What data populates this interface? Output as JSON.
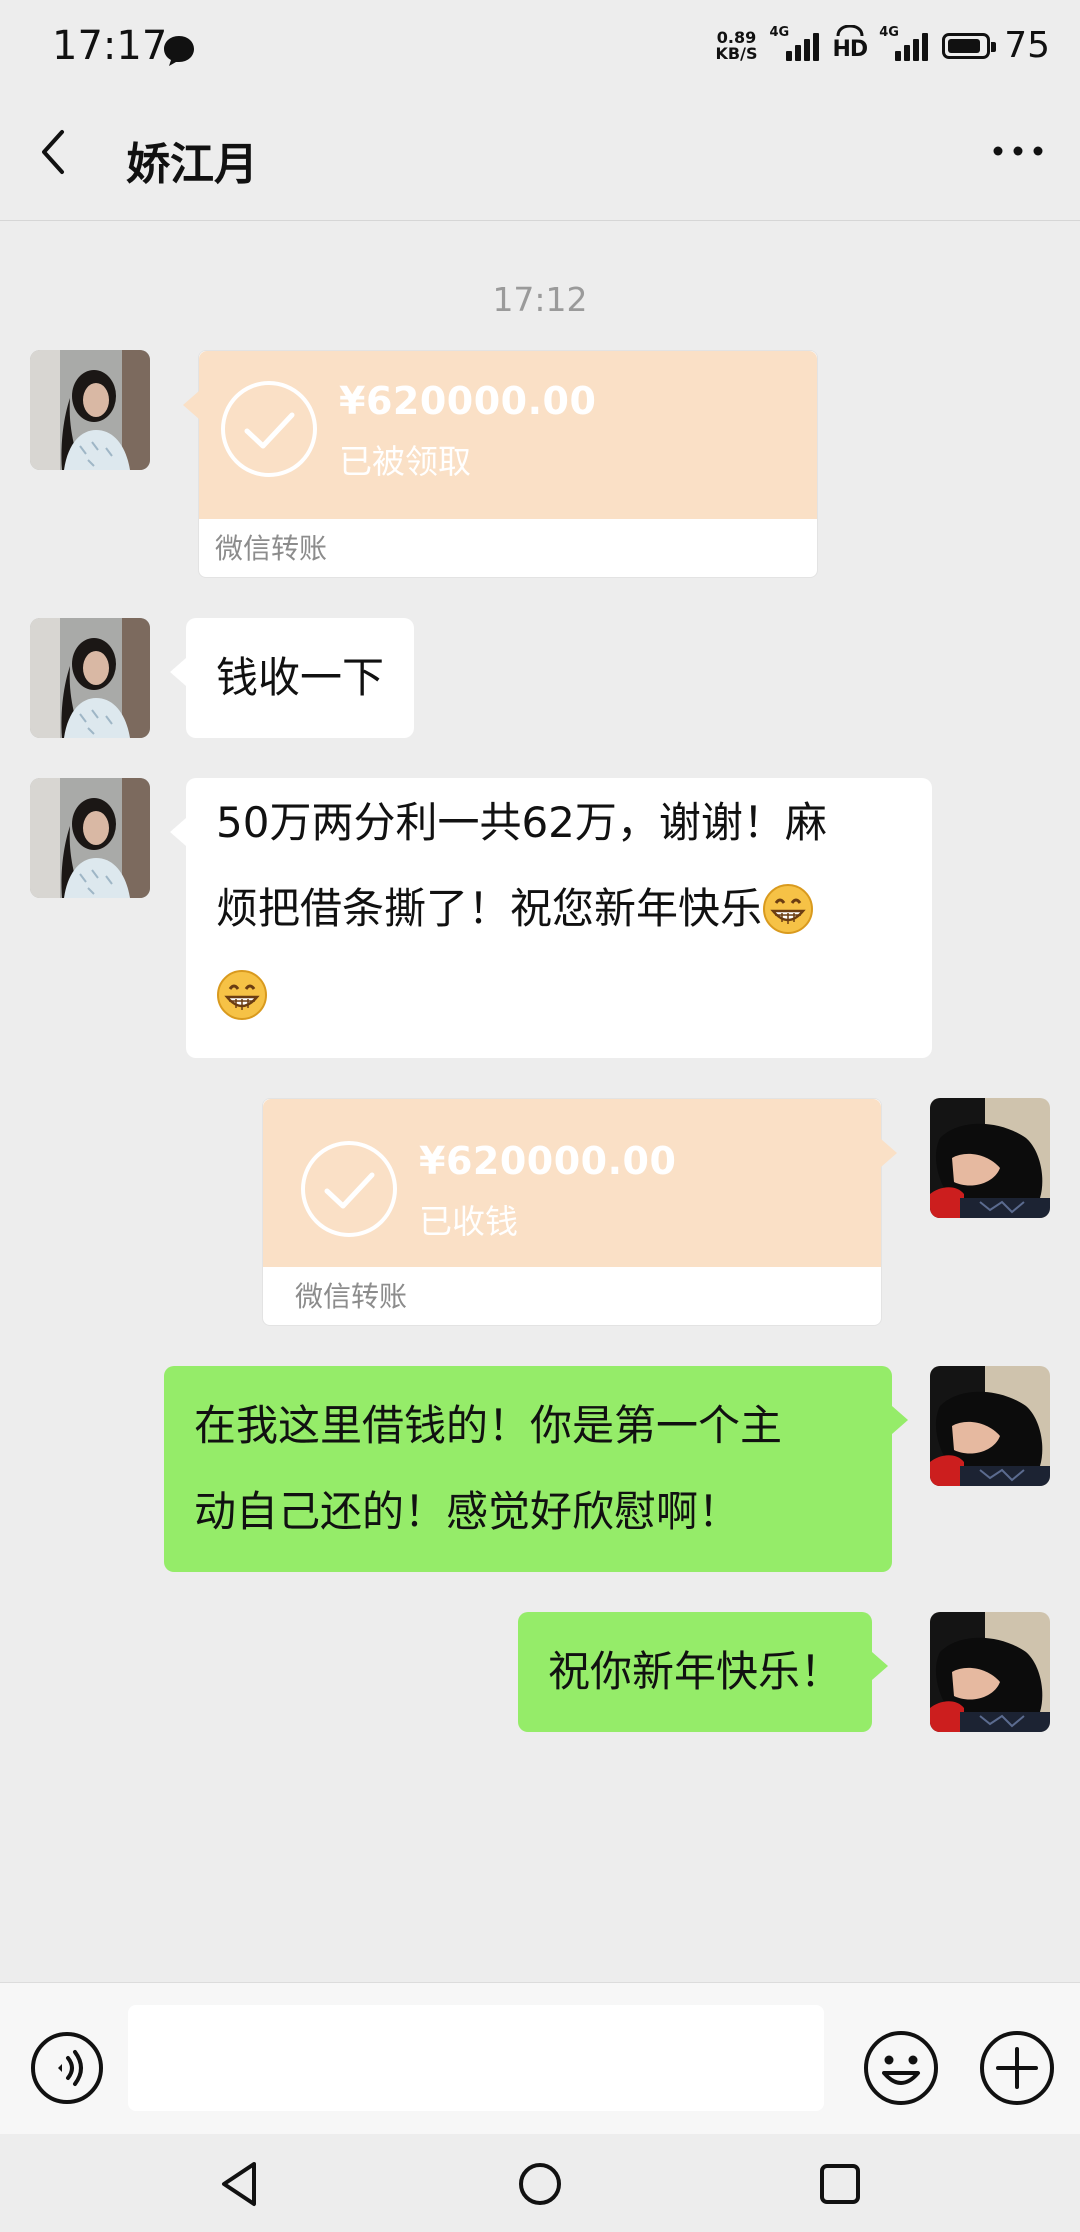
{
  "status_bar": {
    "time": "17:17",
    "net_speed_value": "0.89",
    "net_speed_unit": "KB/S",
    "signal_tag": "4G",
    "hd_label": "HD",
    "battery_percent": "75"
  },
  "nav": {
    "title": "娇江月"
  },
  "chat": {
    "timestamp": "17:12",
    "messages": [
      {
        "side": "left",
        "type": "transfer",
        "amount": "¥620000.00",
        "status": "已被领取",
        "label": "微信转账"
      },
      {
        "side": "left",
        "type": "text",
        "text": "钱收一下"
      },
      {
        "side": "left",
        "type": "text",
        "line1": "50万两分利一共62万，谢谢！麻",
        "line2": "烦把借条撕了！祝您新年快乐"
      },
      {
        "side": "right",
        "type": "transfer",
        "amount": "¥620000.00",
        "status": "已收钱",
        "label": "微信转账"
      },
      {
        "side": "right",
        "type": "text",
        "line1": "在我这里借钱的！你是第一个主",
        "line2": "动自己还的！感觉好欣慰啊！"
      },
      {
        "side": "right",
        "type": "text",
        "text": "祝你新年快乐！"
      }
    ]
  },
  "input_bar": {
    "placeholder": ""
  },
  "colors": {
    "background": "#ededed",
    "transfer_orange": "#fae0c6",
    "self_bubble_green": "#95ec69"
  }
}
